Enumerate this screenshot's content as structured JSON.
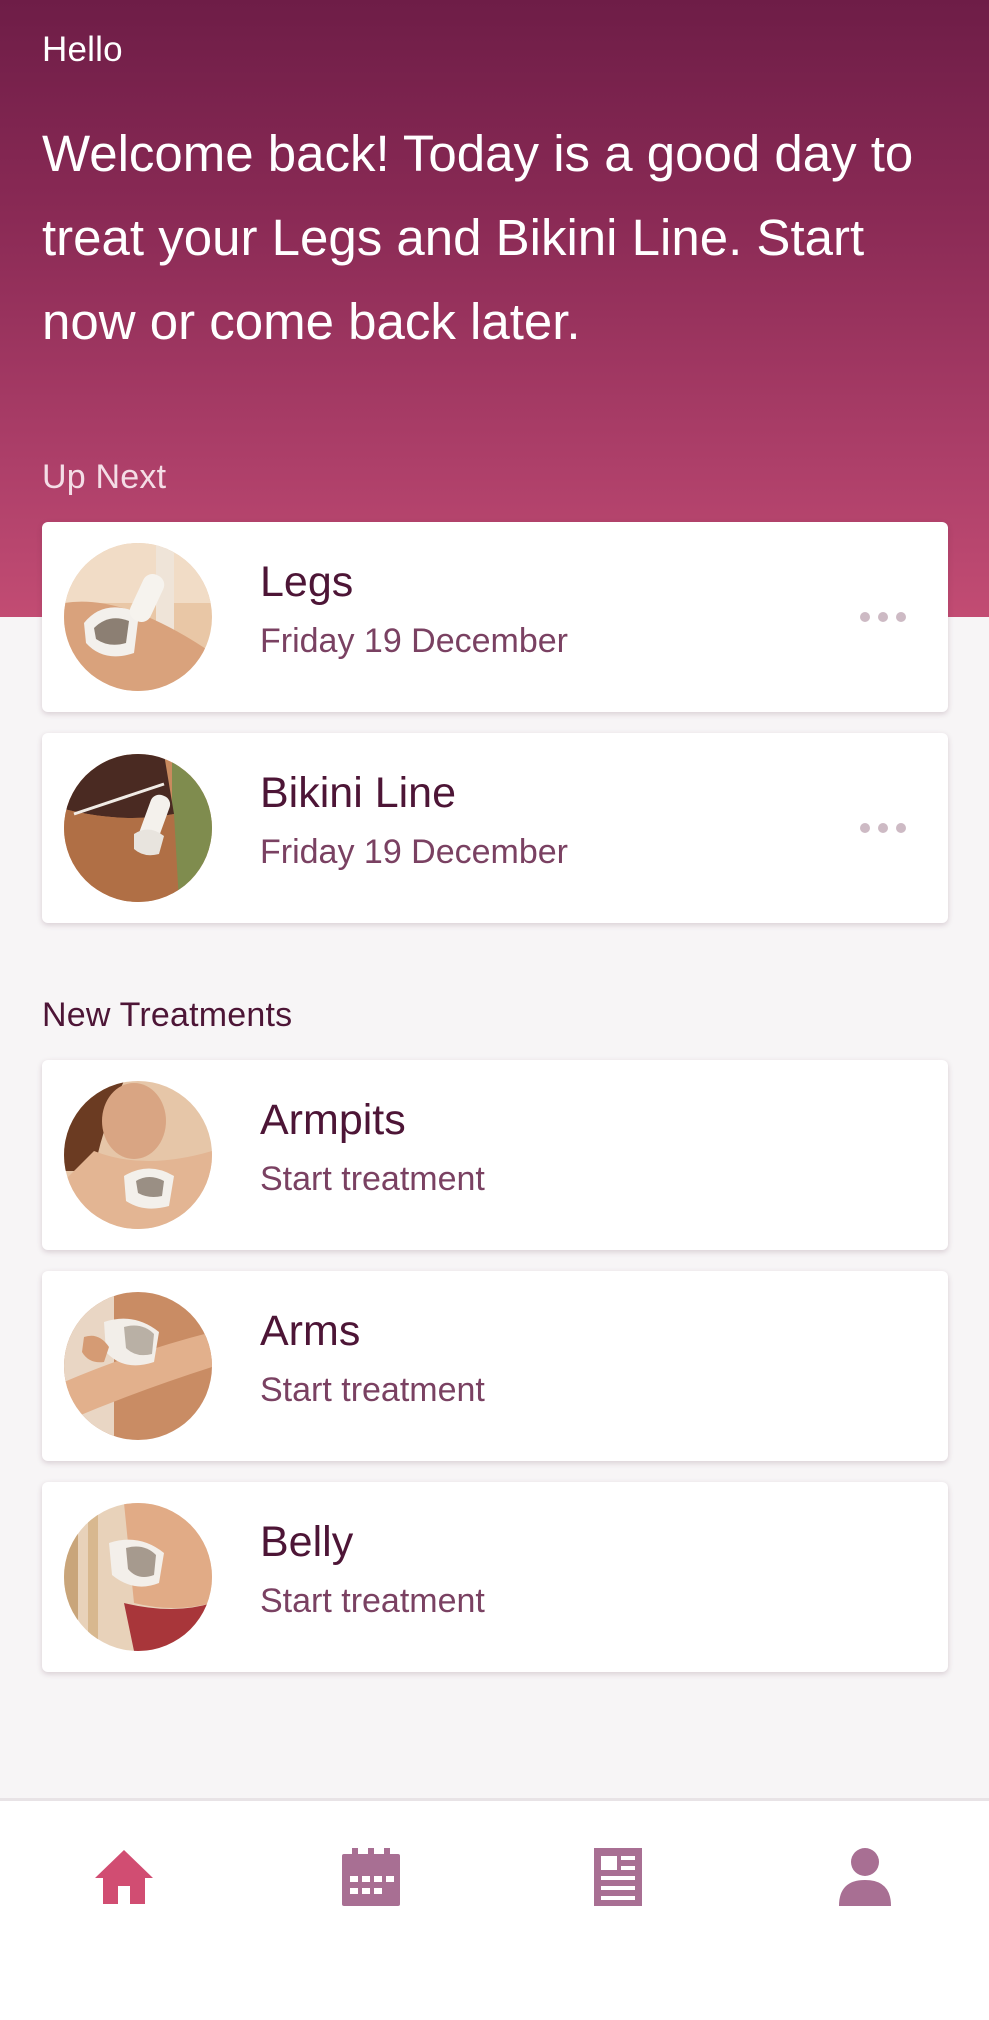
{
  "greeting": "Hello",
  "welcome_message": "Welcome back! Today is a good day to treat your Legs and Bikini Line. Start now or come back later.",
  "up_next": {
    "label": "Up Next",
    "items": [
      {
        "title": "Legs",
        "subtitle": "Friday 19 December",
        "image": "legs-treatment-photo",
        "more_icon": "more-horizontal-icon"
      },
      {
        "title": "Bikini Line",
        "subtitle": "Friday 19 December",
        "image": "bikini-line-treatment-photo",
        "more_icon": "more-horizontal-icon"
      }
    ]
  },
  "new_treatments": {
    "label": "New Treatments",
    "items": [
      {
        "title": "Armpits",
        "subtitle": "Start treatment",
        "image": "armpits-treatment-photo"
      },
      {
        "title": "Arms",
        "subtitle": "Start treatment",
        "image": "arms-treatment-photo"
      },
      {
        "title": "Belly",
        "subtitle": "Start treatment",
        "image": "belly-treatment-photo"
      }
    ]
  },
  "bottom_nav": {
    "items": [
      {
        "icon": "home-icon",
        "active": true
      },
      {
        "icon": "calendar-icon",
        "active": false
      },
      {
        "icon": "articles-icon",
        "active": false
      },
      {
        "icon": "profile-icon",
        "active": false
      }
    ]
  },
  "colors": {
    "header_gradient_top": "#6e1d47",
    "header_gradient_bottom": "#c24c73",
    "title_text": "#4d1536",
    "subtitle_text": "#7a4162",
    "nav_active": "#d14d72",
    "nav_inactive": "#a86f93",
    "background": "#f7f5f6"
  }
}
